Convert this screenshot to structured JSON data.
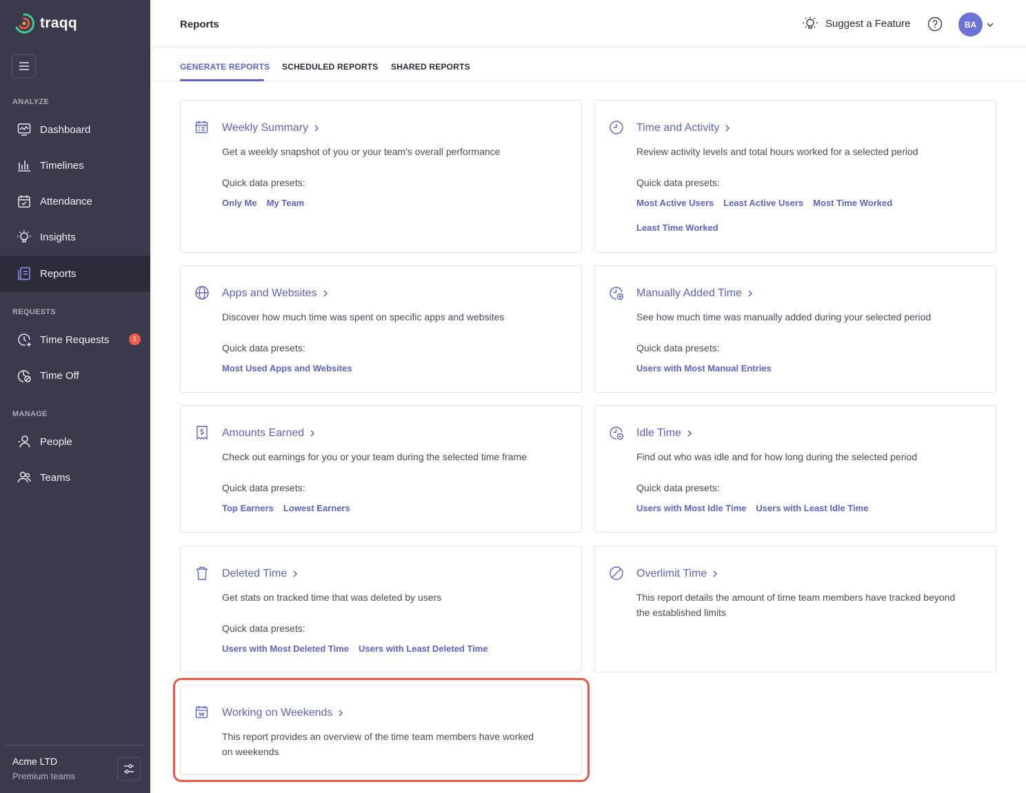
{
  "app": {
    "name": "traqq"
  },
  "sidebar": {
    "sections": {
      "analyze": "ANALYZE",
      "requests": "REQUESTS",
      "manage": "MANAGE"
    },
    "items": [
      {
        "label": "Dashboard",
        "icon": "dashboard-icon"
      },
      {
        "label": "Timelines",
        "icon": "timelines-icon"
      },
      {
        "label": "Attendance",
        "icon": "attendance-icon"
      },
      {
        "label": "Insights",
        "icon": "insights-icon"
      },
      {
        "label": "Reports",
        "icon": "reports-icon",
        "active": true
      },
      {
        "label": "Time Requests",
        "icon": "time-requests-icon",
        "badge": "1"
      },
      {
        "label": "Time Off",
        "icon": "time-off-icon"
      },
      {
        "label": "People",
        "icon": "people-icon"
      },
      {
        "label": "Teams",
        "icon": "teams-icon"
      }
    ],
    "footer": {
      "org_name": "Acme LTD",
      "plan": "Premium teams"
    }
  },
  "header": {
    "title": "Reports",
    "suggest_label": "Suggest a Feature",
    "avatar_initials": "BA"
  },
  "tabs": [
    {
      "label": "GENERATE REPORTS",
      "active": true
    },
    {
      "label": "SCHEDULED REPORTS"
    },
    {
      "label": "SHARED REPORTS"
    }
  ],
  "presets_label": "Quick data presets:",
  "cards": [
    {
      "title": "Weekly Summary",
      "desc": "Get a weekly snapshot of you or your team's overall performance",
      "presets": [
        "Only Me",
        "My Team"
      ]
    },
    {
      "title": "Time and Activity",
      "desc": "Review activity levels and total hours worked for a selected period",
      "presets": [
        "Most Active Users",
        "Least Active Users",
        "Most Time Worked",
        "Least Time Worked"
      ]
    },
    {
      "title": "Apps and Websites",
      "desc": "Discover how much time was spent on specific apps and websites",
      "presets": [
        "Most Used Apps and Websites"
      ]
    },
    {
      "title": "Manually Added Time",
      "desc": "See how much time was manually added during your selected period",
      "presets": [
        "Users with Most Manual Entries"
      ]
    },
    {
      "title": "Amounts Earned",
      "desc": "Check out earnings for you or your team during the selected time frame",
      "presets": [
        "Top Earners",
        "Lowest Earners"
      ]
    },
    {
      "title": "Idle Time",
      "desc": "Find out who was idle and for how long during the selected period",
      "presets": [
        "Users with Most Idle Time",
        "Users with Least Idle Time"
      ]
    },
    {
      "title": "Deleted Time",
      "desc": "Get stats on tracked time that was deleted by users",
      "presets": [
        "Users with Most Deleted Time",
        "Users with Least Deleted Time"
      ]
    },
    {
      "title": "Overlimit Time",
      "desc": "This report details the amount of time team members have tracked beyond the established limits"
    },
    {
      "title": "Working on Weekends",
      "desc": "This report provides an overview of the time team members have worked on weekends"
    }
  ],
  "colors": {
    "sidebar": "#3a3a4c",
    "accent": "#5b63c9",
    "highlight": "#f0553f",
    "badge": "#f05b4a"
  }
}
